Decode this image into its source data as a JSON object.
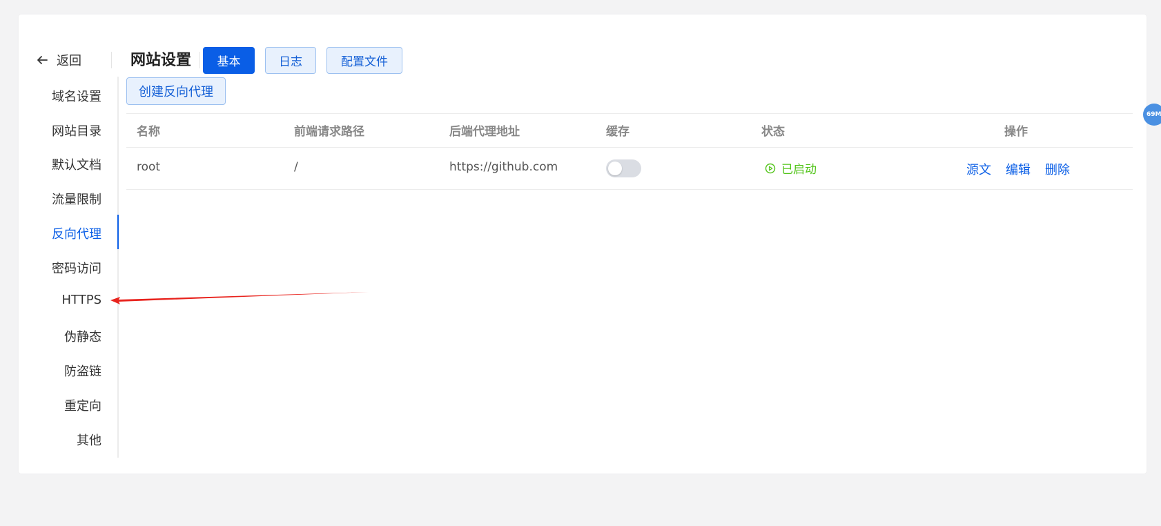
{
  "header": {
    "back_label": "返回",
    "title": "网站设置",
    "tabs": [
      {
        "label": "基本",
        "active": true
      },
      {
        "label": "日志",
        "active": false
      },
      {
        "label": "配置文件",
        "active": false
      }
    ]
  },
  "sidebar": {
    "items": [
      {
        "label": "域名设置"
      },
      {
        "label": "网站目录"
      },
      {
        "label": "默认文档"
      },
      {
        "label": "流量限制"
      },
      {
        "label": "反向代理",
        "active": true
      },
      {
        "label": "密码访问"
      },
      {
        "label": "HTTPS"
      },
      {
        "label": "伪静态"
      },
      {
        "label": "防盗链"
      },
      {
        "label": "重定向"
      },
      {
        "label": "其他"
      }
    ]
  },
  "main": {
    "create_button": "创建反向代理",
    "table": {
      "columns": [
        "名称",
        "前端请求路径",
        "后端代理地址",
        "缓存",
        "状态",
        "操作"
      ],
      "rows": [
        {
          "name": "root",
          "path": "/",
          "backend": "https://github.com",
          "cache_enabled": false,
          "status": "已启动",
          "actions": [
            "源文",
            "编辑",
            "删除"
          ]
        }
      ]
    }
  },
  "floating_badge": "69M",
  "colors": {
    "primary": "#0a5ee6",
    "status_running": "#52c41a",
    "annotation_arrow": "#e8231d"
  }
}
